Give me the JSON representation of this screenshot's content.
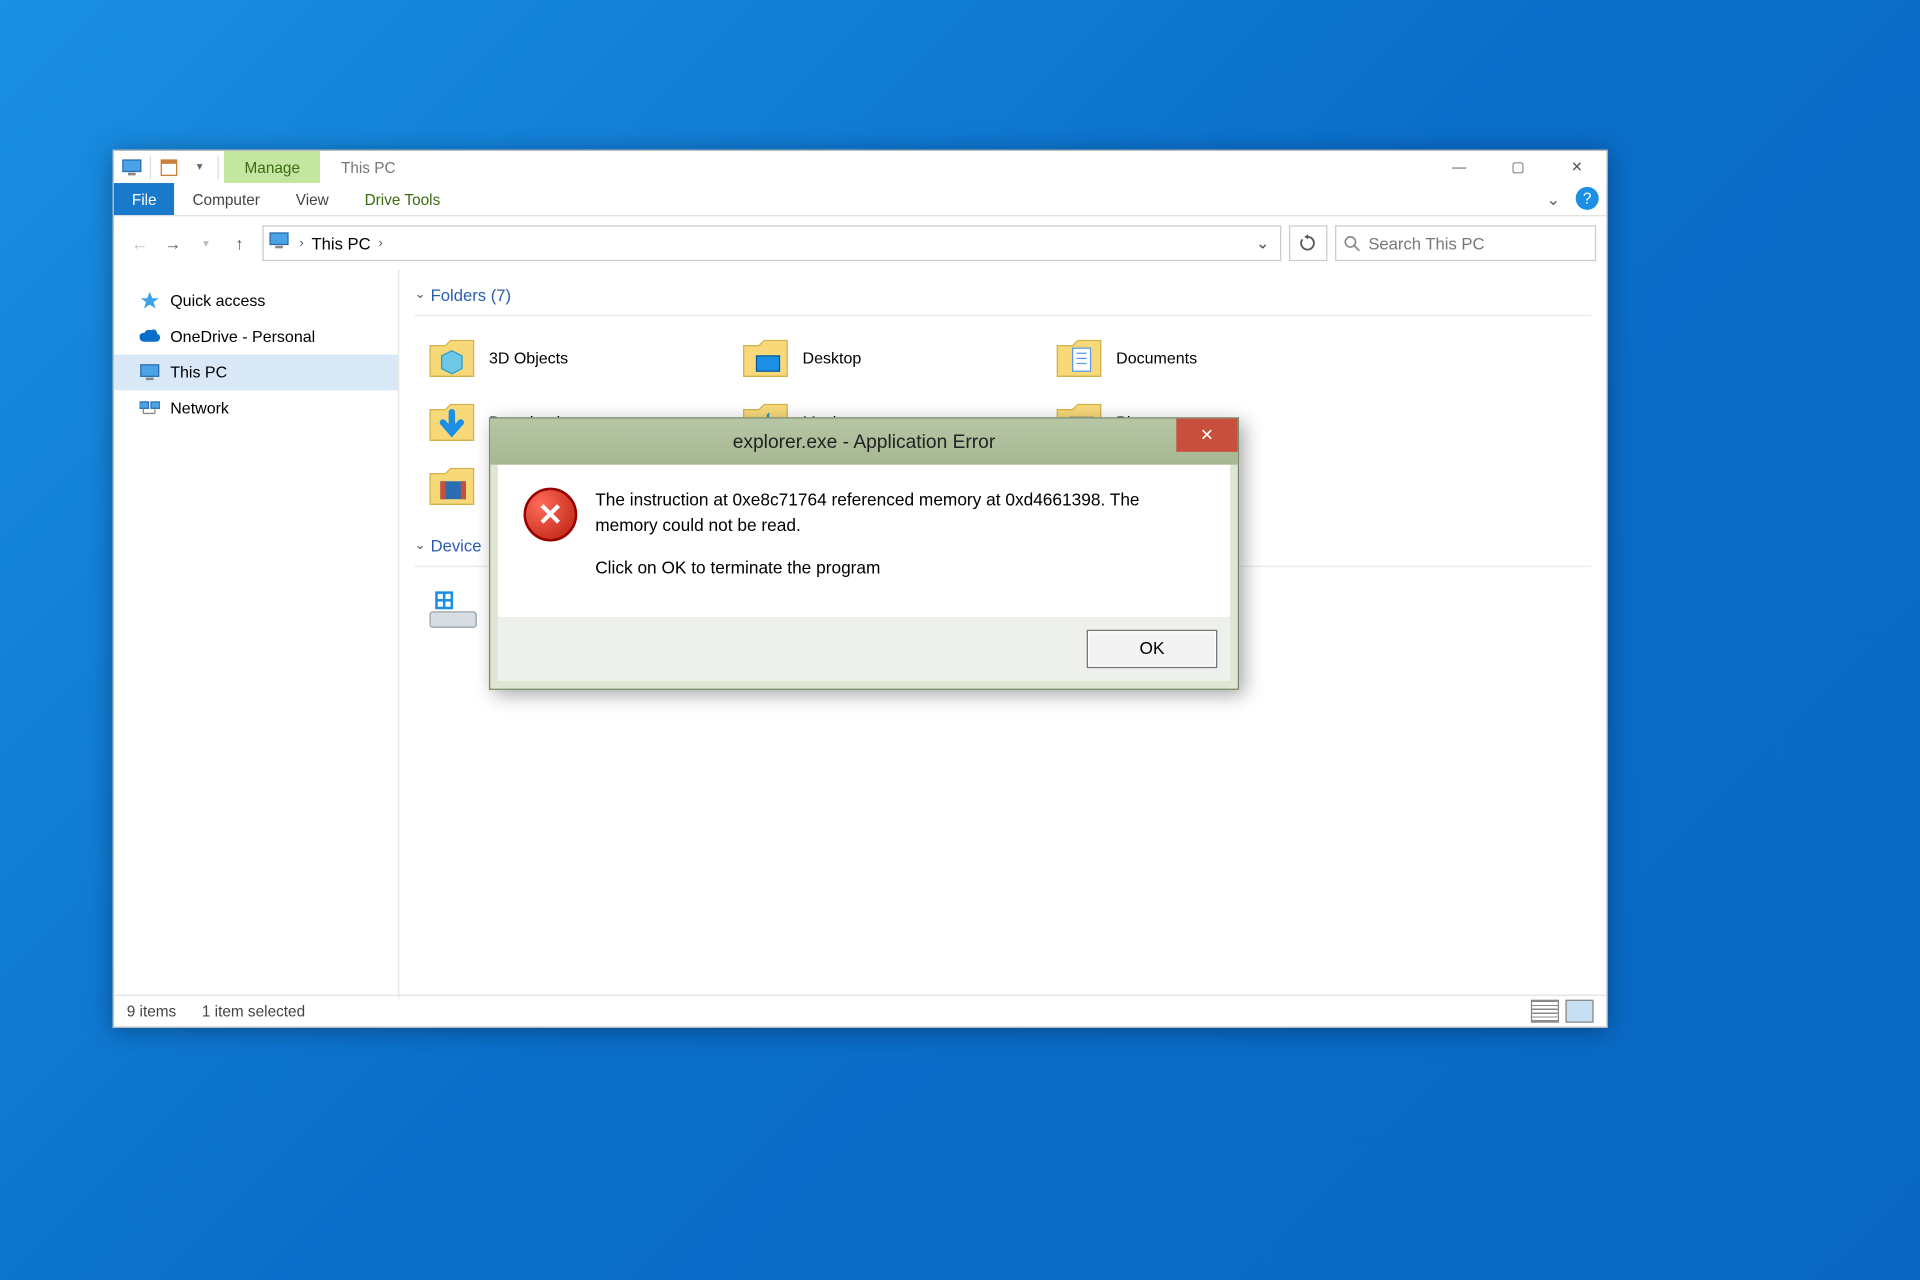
{
  "window": {
    "context_tab": "Manage",
    "context_sub": "Drive Tools",
    "title_tab": "This PC",
    "tabs": {
      "file": "File",
      "computer": "Computer",
      "view": "View"
    },
    "win_buttons": {
      "min": "—",
      "max": "▢",
      "close": "✕"
    }
  },
  "nav": {
    "location": "This PC",
    "search_placeholder": "Search This PC"
  },
  "sidebar": {
    "quick_access": "Quick access",
    "onedrive": "OneDrive - Personal",
    "this_pc": "This PC",
    "network": "Network"
  },
  "content": {
    "folders_header": "Folders (7)",
    "devices_header": "Device",
    "folders": [
      {
        "label": "3D Objects"
      },
      {
        "label": "Desktop"
      },
      {
        "label": "Documents"
      },
      {
        "label": "Downloads"
      },
      {
        "label": "Music"
      },
      {
        "label": "Pictures"
      },
      {
        "label": "Videos"
      }
    ]
  },
  "statusbar": {
    "items": "9 items",
    "selected": "1 item selected"
  },
  "error_dialog": {
    "title": "explorer.exe - Application Error",
    "message1": "The instruction at 0xe8c71764 referenced memory at 0xd4661398. The memory could not be read.",
    "message2": "Click on OK to terminate the program",
    "ok_label": "OK",
    "close_label": "✕"
  }
}
